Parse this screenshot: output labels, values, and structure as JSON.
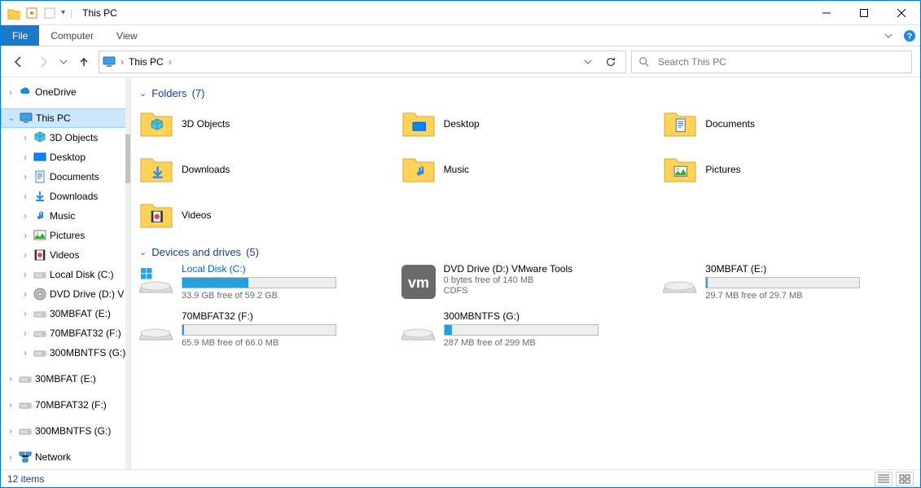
{
  "title": "This PC",
  "ribbon": {
    "file": "File",
    "computer": "Computer",
    "view": "View"
  },
  "address": {
    "location": "This PC"
  },
  "search": {
    "placeholder": "Search This PC"
  },
  "sidebar": {
    "onedrive": "OneDrive",
    "thispc": "This PC",
    "thispc_children": {
      "objects3d": "3D Objects",
      "desktop": "Desktop",
      "documents": "Documents",
      "downloads": "Downloads",
      "music": "Music",
      "pictures": "Pictures",
      "videos": "Videos",
      "local_c": "Local Disk (C:)",
      "dvd_d": "DVD Drive (D:) V",
      "fat30_e": "30MBFAT (E:)",
      "fat32_f": "70MBFAT32 (F:)",
      "ntfs_g": "300MBNTFS (G:)"
    },
    "ext": {
      "fat30_e": "30MBFAT (E:)",
      "fat32_f": "70MBFAT32 (F:)",
      "ntfs_g": "300MBNTFS (G:)"
    },
    "network": "Network"
  },
  "groups": {
    "folders": {
      "title": "Folders",
      "count": "(7)"
    },
    "drives": {
      "title": "Devices and drives",
      "count": "(5)"
    }
  },
  "folders": {
    "objects3d": "3D Objects",
    "desktop": "Desktop",
    "documents": "Documents",
    "downloads": "Downloads",
    "music": "Music",
    "pictures": "Pictures",
    "videos": "Videos"
  },
  "drives": {
    "c": {
      "name": "Local Disk (C:)",
      "free": "33.9 GB free of 59.2 GB",
      "fill_pct": 43
    },
    "d": {
      "name": "DVD Drive (D:) VMware Tools",
      "free": "0 bytes free of 140 MB",
      "fs": "CDFS"
    },
    "e": {
      "name": "30MBFAT (E:)",
      "free": "29.7 MB free of 29.7 MB",
      "fill_pct": 1
    },
    "f": {
      "name": "70MBFAT32 (F:)",
      "free": "65.9 MB free of 66.0 MB",
      "fill_pct": 1
    },
    "g": {
      "name": "300MBNTFS (G:)",
      "free": "287 MB free of 299 MB",
      "fill_pct": 5
    }
  },
  "status": {
    "items": "12 items"
  }
}
